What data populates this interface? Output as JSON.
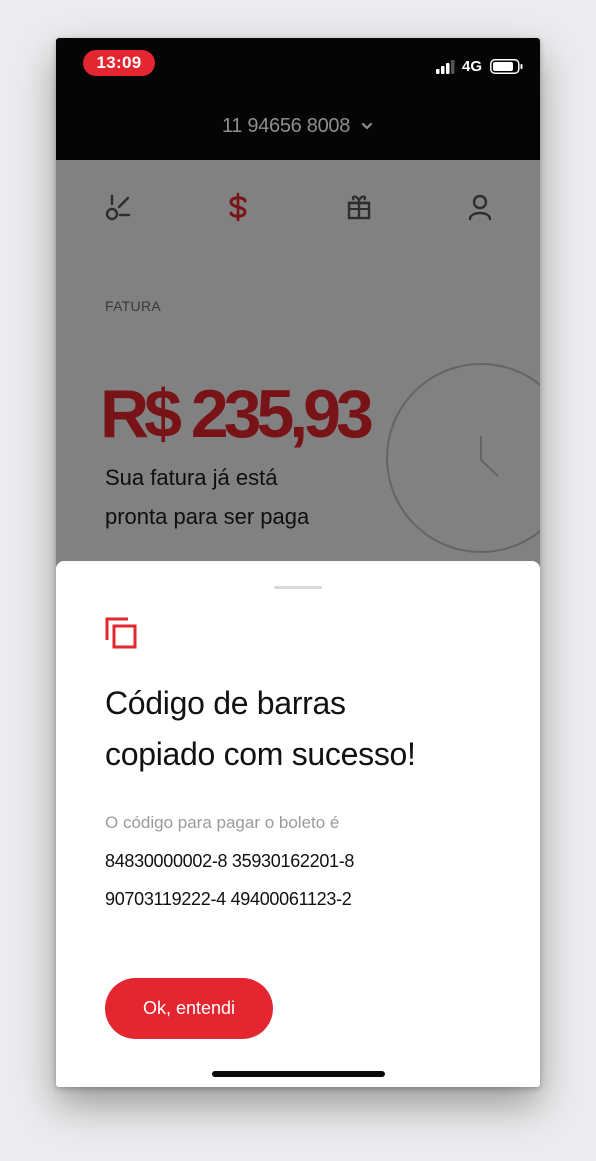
{
  "status_bar": {
    "time": "13:09",
    "network": "4G",
    "icons": [
      "signal-bars-icon",
      "battery-icon"
    ]
  },
  "header": {
    "phone_number": "11 94656 8008",
    "dropdown_icon": "chevron-down-icon"
  },
  "nav": {
    "items": [
      {
        "icon": "plans-icon"
      },
      {
        "icon": "dollar-icon",
        "active": true
      },
      {
        "icon": "gift-icon"
      },
      {
        "icon": "user-icon"
      }
    ]
  },
  "invoice": {
    "section_label": "FATURA",
    "amount": "R$ 235,93",
    "subtitle_line1": "Sua fatura já está",
    "subtitle_line2": "pronta para ser paga"
  },
  "sheet": {
    "icon": "copy-icon",
    "title_line1": "Código de barras",
    "title_line2": "copiado com sucesso!",
    "description": "O código para pagar o boleto é",
    "barcode_line1": "84830000002-8 35930162201-8",
    "barcode_line2": "90703119222-4 49400061123-2",
    "ok_label": "Ok, entendi"
  },
  "colors": {
    "accent": "#e3262f",
    "status_bar_bg": "#050505",
    "overlay": "rgba(0,0,0,0.47)"
  }
}
